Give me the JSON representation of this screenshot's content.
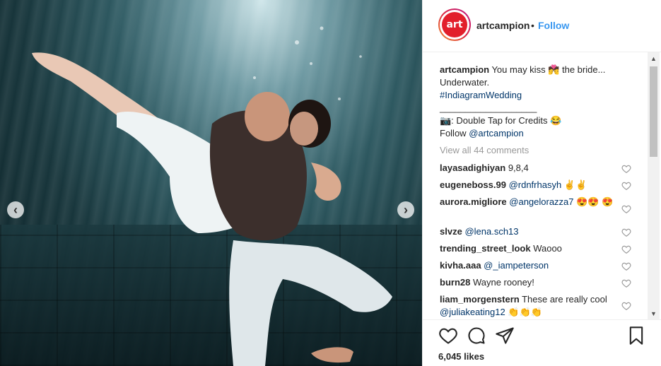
{
  "post": {
    "username": "artcampion",
    "dot": "•",
    "follow_label": "Follow",
    "avatar_text": "art"
  },
  "caption": {
    "username": "artcampion",
    "line1": " You may kiss 💏 the bride... Underwater.",
    "hashtag": "#IndiagramWedding",
    "divider": "___________________",
    "credits": "📷: Double Tap for Credits 😂",
    "follow_prefix": "Follow ",
    "follow_mention": "@artcampion"
  },
  "view_all_comments": "View all 44 comments",
  "comments": [
    {
      "user": "layasadighiyan",
      "text": " 9,8,4",
      "mention": ""
    },
    {
      "user": "eugeneboss.99",
      "text": " ✌✌",
      "mention": "@rdnfrhasyh"
    },
    {
      "user": "aurora.migliore",
      "text": " 😍😍 😍",
      "mention": "@angelorazza7"
    },
    {
      "user": "slvze",
      "text": "",
      "mention": "@lena.sch13"
    },
    {
      "user": "trending_street_look",
      "text": " Waooo",
      "mention": ""
    },
    {
      "user": "kivha.aaa",
      "text": "",
      "mention": "@_iampeterson"
    },
    {
      "user": "burn28",
      "text": " Wayne rooney!",
      "mention": ""
    },
    {
      "user": "liam_morgenstern",
      "text": " These are really cool ",
      "mention": "@juliakeating12",
      "suffix": " 👏👏👏"
    }
  ],
  "likes": "6,045 likes",
  "icons": {
    "prev": "chevron-left-icon",
    "next": "chevron-right-icon",
    "like": "heart-icon",
    "comment": "comment-icon",
    "share": "share-icon",
    "save": "bookmark-icon"
  },
  "colors": {
    "accent": "#3897f0",
    "link": "#003569",
    "brand": "#e21f2b"
  }
}
